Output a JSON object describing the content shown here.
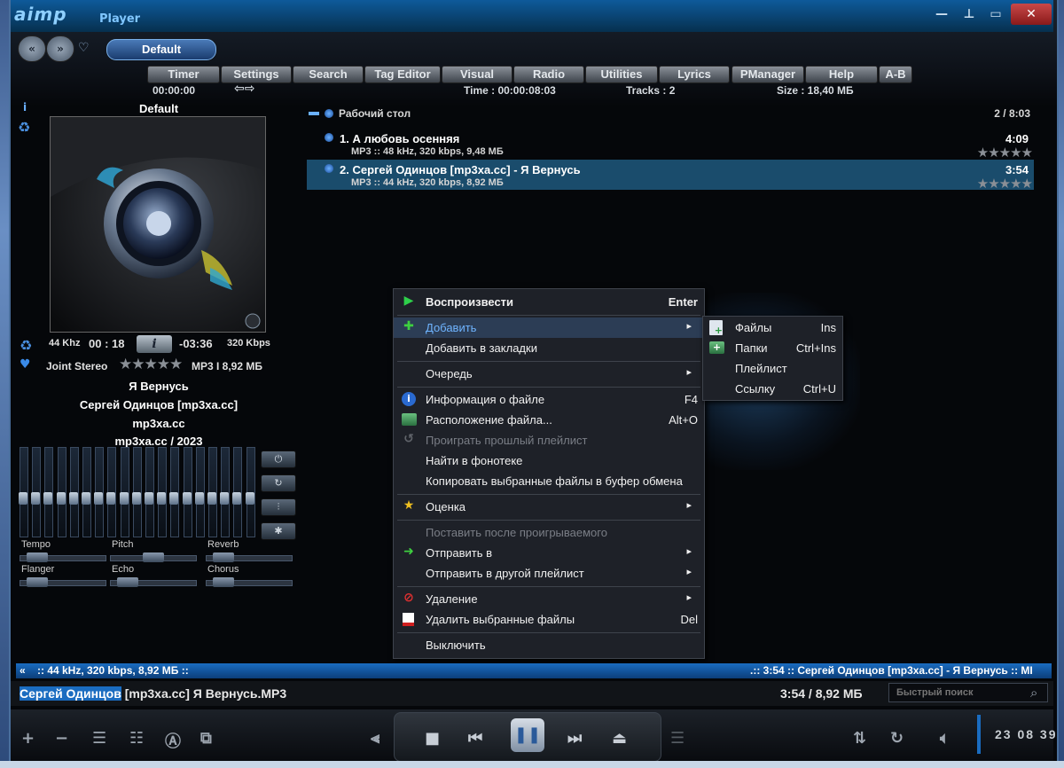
{
  "app": {
    "title": "AIMP Player",
    "logo": "aimp",
    "logo_suffix": "Player"
  },
  "window_controls": {
    "minimize": "—",
    "pin": "⊥",
    "maximize": "▭",
    "close": "✕"
  },
  "header": {
    "preset": "Default",
    "tabs": [
      "Timer",
      "Settings",
      "Search",
      "Tag Editor",
      "Visual",
      "Radio",
      "Utilities",
      "Lyrics",
      "PManager",
      "Help",
      "A-B"
    ],
    "timer": "00:00:00",
    "time": "Time : 00:00:08:03",
    "tracks": "Tracks : 2",
    "size": "Size : 18,40 МБ"
  },
  "left_panel": {
    "title": "Default",
    "khz": "44 Khz",
    "elapsed": "00 : 18",
    "info_button": "i",
    "remaining": "-03:36",
    "kbps": "320 Kbps",
    "channels": "Joint Stereo",
    "stars": "★★★★★",
    "format": "MP3 I 8,92 МБ",
    "song": "Я Вернусь",
    "artist": "Сергей Одинцов [mp3xa.cc]",
    "album": "mp3xa.cc",
    "album_year": "mp3xa.cc / 2023",
    "eq_levels": [
      0.42,
      0.42,
      0.42,
      0.42,
      0.42,
      0.42,
      0.42,
      0.42,
      0.42,
      0.42,
      0.42,
      0.42,
      0.42,
      0.42,
      0.42,
      0.42,
      0.42,
      0.42,
      0.42
    ],
    "effects": [
      {
        "name": "Tempo",
        "level": 0.1
      },
      {
        "name": "Pitch",
        "level": 0.5
      },
      {
        "name": "Reverb",
        "level": 0.1
      },
      {
        "name": "Flanger",
        "level": 0.1
      },
      {
        "name": "Echo",
        "level": 0.1
      },
      {
        "name": "Chorus",
        "level": 0.1
      }
    ]
  },
  "playlist": {
    "name": "Рабочий стол",
    "count": "2 / 8:03",
    "tracks": [
      {
        "title": "1. А любовь осенняя",
        "info": "MP3 :: 48 kHz, 320 kbps, 9,48 МБ",
        "duration": "4:09",
        "stars": "★★★★★"
      },
      {
        "title": "2. Сергей Одинцов [mp3xa.cc] - Я Вернусь",
        "info": "MP3 :: 44 kHz, 320 kbps, 8,92 МБ",
        "duration": "3:54",
        "stars": "★★★★★"
      }
    ]
  },
  "context_menu": {
    "play": "Воспроизвести",
    "play_key": "Enter",
    "add": "Добавить",
    "bookmark": "Добавить в закладки",
    "queue": "Очередь",
    "file_info": "Информация о файле",
    "file_info_key": "F4",
    "file_location": "Расположение файла...",
    "file_location_key": "Alt+O",
    "play_previous": "Проиграть прошлый плейлист",
    "find_library": "Найти в фонотеке",
    "copy_files": "Копировать выбранные файлы в буфер обмена",
    "rating": "Оценка",
    "after_current": "Поставить после проигрываемого",
    "send_to": "Отправить в",
    "send_other": "Отправить в другой плейлист",
    "delete": "Удаление",
    "delete_files": "Удалить выбранные файлы",
    "delete_files_key": "Del",
    "shutdown": "Выключить"
  },
  "submenu": {
    "files": "Файлы",
    "files_key": "Ins",
    "folders": "Папки",
    "folders_key": "Ctrl+Ins",
    "playlist": "Плейлист",
    "link": "Ссылку",
    "link_key": "Ctrl+U"
  },
  "ticker": {
    "left": ":: 44 kHz, 320 kbps, 8,92 МБ ::",
    "right": ".:: 3:54 :: Сергей Одинцов [mp3xa.cc] - Я Вернусь :: МІ"
  },
  "now_playing": {
    "title_highlight": "Сергей Одинцов",
    "title_rest": " [mp3xa.cc]  Я Вернусь.MP3",
    "time": "3:54 / 8,92 МБ"
  },
  "search": {
    "placeholder": "Быстрый поиск"
  },
  "clock": "23 08 39",
  "colors": {
    "accent": "#1a6cc0",
    "selection": "#1a4c6c",
    "menu_bg": "#1e2128",
    "menu_highlight": "#6fb4ff"
  }
}
